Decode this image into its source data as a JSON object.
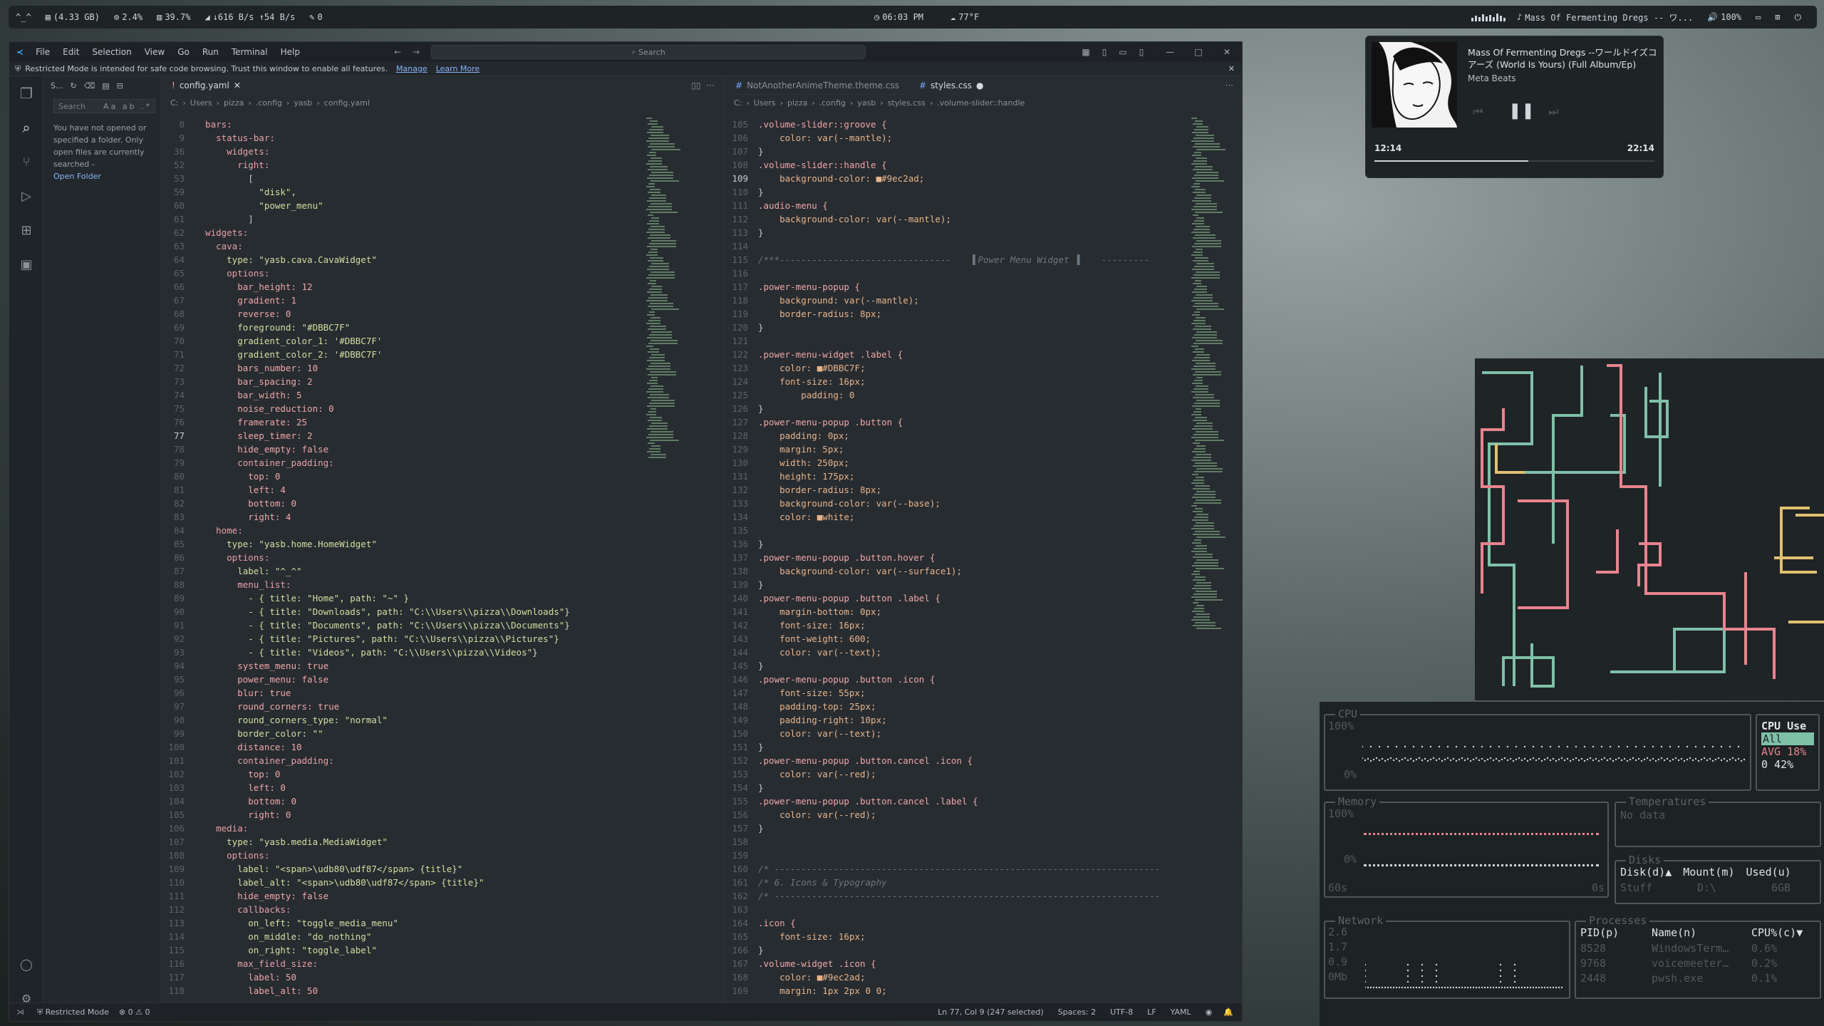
{
  "statusbar": {
    "logo": "^_^",
    "memory": "(4.33 GB)",
    "cpu": "2.4%",
    "ram": "39.7%",
    "network": "↓616 B/s ↑54 B/s",
    "notes": "0",
    "time": "06:03 PM",
    "weather": "77°F",
    "now_playing": "Mass Of Fermenting Dregs -- ワ...",
    "volume": "100%"
  },
  "vscode": {
    "menus": [
      "File",
      "Edit",
      "Selection",
      "View",
      "Go",
      "Run",
      "Terminal",
      "Help"
    ],
    "search_placeholder": "Search",
    "restricted_text": "Restricted Mode is intended for safe code browsing. Trust this window to enable all features.",
    "manage": "Manage",
    "learn_more": "Learn More",
    "sidebar": {
      "title": "S...",
      "search_placeholder": "Search",
      "message": "You have not opened or specified a folder. Only open files are currently searched -",
      "open_folder": "Open Folder"
    },
    "left_tab": "config.yaml",
    "left_crumbs": [
      "C:",
      "Users",
      "pizza",
      ".config",
      "yasb",
      "config.yaml"
    ],
    "right_tabs": [
      "NotAnotherAnimeTheme.theme.css",
      "styles.css"
    ],
    "right_crumbs": [
      "C:",
      "Users",
      "pizza",
      ".config",
      "yasb",
      "styles.css",
      ".volume-slider::handle"
    ],
    "status": {
      "mode": "Restricted Mode",
      "problems": "0 ⚠ 0",
      "position": "Ln 77, Col 9 (247 selected)",
      "spaces": "Spaces: 2",
      "encoding": "UTF-8",
      "eol": "LF",
      "language": "YAML"
    }
  },
  "yaml_lines": [
    [
      "8",
      "  bars:"
    ],
    [
      "9",
      "    status-bar:"
    ],
    [
      "36",
      "      widgets:"
    ],
    [
      "52",
      "        right:"
    ],
    [
      "53",
      "          ["
    ],
    [
      "59",
      "            \"disk\","
    ],
    [
      "60",
      "            \"power_menu\""
    ],
    [
      "61",
      "          ]"
    ],
    [
      "62",
      "  widgets:"
    ],
    [
      "63",
      "    cava:"
    ],
    [
      "64",
      "      type: \"yasb.cava.CavaWidget\""
    ],
    [
      "65",
      "      options:"
    ],
    [
      "66",
      "        bar_height: 12"
    ],
    [
      "67",
      "        gradient: 1"
    ],
    [
      "68",
      "        reverse: 0"
    ],
    [
      "69",
      "        foreground: \"#DBBC7F\""
    ],
    [
      "70",
      "        gradient_color_1: '#DBBC7F'"
    ],
    [
      "71",
      "        gradient_color_2: '#DBBC7F'"
    ],
    [
      "72",
      "        bars_number: 10"
    ],
    [
      "73",
      "        bar_spacing: 2"
    ],
    [
      "74",
      "        bar_width: 5"
    ],
    [
      "75",
      "        noise_reduction: 0"
    ],
    [
      "76",
      "        framerate: 25"
    ],
    [
      "77",
      "        sleep_timer: 2"
    ],
    [
      "78",
      "        hide_empty: false"
    ],
    [
      "79",
      "        container_padding:"
    ],
    [
      "80",
      "          top: 0"
    ],
    [
      "81",
      "          left: 4"
    ],
    [
      "82",
      "          bottom: 0"
    ],
    [
      "83",
      "          right: 4"
    ],
    [
      "84",
      "    home:"
    ],
    [
      "85",
      "      type: \"yasb.home.HomeWidget\""
    ],
    [
      "86",
      "      options:"
    ],
    [
      "87",
      "        label: \"^_^\""
    ],
    [
      "88",
      "        menu_list:"
    ],
    [
      "89",
      "          - { title: \"Home\", path: \"~\" }"
    ],
    [
      "90",
      "          - { title: \"Downloads\", path: \"C:\\\\Users\\\\pizza\\\\Downloads\"}"
    ],
    [
      "91",
      "          - { title: \"Documents\", path: \"C:\\\\Users\\\\pizza\\\\Documents\"}"
    ],
    [
      "92",
      "          - { title: \"Pictures\", path: \"C:\\\\Users\\\\pizza\\\\Pictures\"}"
    ],
    [
      "93",
      "          - { title: \"Videos\", path: \"C:\\\\Users\\\\pizza\\\\Videos\"}"
    ],
    [
      "94",
      "        system_menu: true"
    ],
    [
      "95",
      "        power_menu: false"
    ],
    [
      "96",
      "        blur: true"
    ],
    [
      "97",
      "        round_corners: true"
    ],
    [
      "98",
      "        round_corners_type: \"normal\""
    ],
    [
      "99",
      "        border_color: \"\""
    ],
    [
      "100",
      "        distance: 10"
    ],
    [
      "101",
      "        container_padding:"
    ],
    [
      "102",
      "          top: 0"
    ],
    [
      "103",
      "          left: 0"
    ],
    [
      "104",
      "          bottom: 0"
    ],
    [
      "105",
      "          right: 0"
    ],
    [
      "106",
      "    media:"
    ],
    [
      "107",
      "      type: \"yasb.media.MediaWidget\""
    ],
    [
      "108",
      "      options:"
    ],
    [
      "109",
      "        label: \"<span>\\udb80\\udf87</span> {title}\""
    ],
    [
      "110",
      "        label_alt: \"<span>\\udb80\\udf87</span> {title}\""
    ],
    [
      "111",
      "        hide_empty: false"
    ],
    [
      "112",
      "        callbacks:"
    ],
    [
      "113",
      "          on_left: \"toggle_media_menu\""
    ],
    [
      "114",
      "          on_middle: \"do_nothing\""
    ],
    [
      "115",
      "          on_right: \"toggle_label\""
    ],
    [
      "116",
      "        max_field_size:"
    ],
    [
      "117",
      "          label: 50"
    ],
    [
      "118",
      "          label_alt: 50"
    ]
  ],
  "css_lines": [
    [
      "105",
      ".volume-slider::groove {"
    ],
    [
      "106",
      "    color: var(--mantle);"
    ],
    [
      "107",
      "}"
    ],
    [
      "108",
      ".volume-slider::handle {"
    ],
    [
      "109",
      "    background-color: ■#9ec2ad;"
    ],
    [
      "110",
      "}"
    ],
    [
      "111",
      ".audio-menu {"
    ],
    [
      "112",
      "    background-color: var(--mantle);"
    ],
    [
      "113",
      "}"
    ],
    [
      "114",
      ""
    ],
    [
      "115",
      "/***--------------------------------    ▌Power Menu Widget ▐    ---------"
    ],
    [
      "116",
      ""
    ],
    [
      "117",
      ".power-menu-popup {"
    ],
    [
      "118",
      "    background: var(--mantle);"
    ],
    [
      "119",
      "    border-radius: 8px;"
    ],
    [
      "120",
      "}"
    ],
    [
      "121",
      ""
    ],
    [
      "122",
      ".power-menu-widget .label {"
    ],
    [
      "123",
      "    color: ■#DBBC7F;"
    ],
    [
      "124",
      "    font-size: 16px;"
    ],
    [
      "125",
      "        padding: 0"
    ],
    [
      "126",
      "}"
    ],
    [
      "127",
      ".power-menu-popup .button {"
    ],
    [
      "128",
      "    padding: 0px;"
    ],
    [
      "129",
      "    margin: 5px;"
    ],
    [
      "130",
      "    width: 250px;"
    ],
    [
      "131",
      "    height: 175px;"
    ],
    [
      "132",
      "    border-radius: 8px;"
    ],
    [
      "133",
      "    background-color: var(--base);"
    ],
    [
      "134",
      "    color: ■white;"
    ],
    [
      "135",
      ""
    ],
    [
      "136",
      "}"
    ],
    [
      "137",
      ".power-menu-popup .button.hover {"
    ],
    [
      "138",
      "    background-color: var(--surface1);"
    ],
    [
      "139",
      "}"
    ],
    [
      "140",
      ".power-menu-popup .button .label {"
    ],
    [
      "141",
      "    margin-bottom: 0px;"
    ],
    [
      "142",
      "    font-size: 16px;"
    ],
    [
      "143",
      "    font-weight: 600;"
    ],
    [
      "144",
      "    color: var(--text);"
    ],
    [
      "145",
      "}"
    ],
    [
      "146",
      ".power-menu-popup .button .icon {"
    ],
    [
      "147",
      "    font-size: 55px;"
    ],
    [
      "148",
      "    padding-top: 25px;"
    ],
    [
      "149",
      "    padding-right: 10px;"
    ],
    [
      "150",
      "    color: var(--text);"
    ],
    [
      "151",
      "}"
    ],
    [
      "152",
      ".power-menu-popup .button.cancel .icon {"
    ],
    [
      "153",
      "    color: var(--red);"
    ],
    [
      "154",
      "}"
    ],
    [
      "155",
      ".power-menu-popup .button.cancel .label {"
    ],
    [
      "156",
      "    color: var(--red);"
    ],
    [
      "157",
      "}"
    ],
    [
      "158",
      ""
    ],
    [
      "159",
      ""
    ],
    [
      "160",
      "/* ------------------------------------------------------------------------"
    ],
    [
      "161",
      "/* 6. Icons & Typography"
    ],
    [
      "162",
      "/* ------------------------------------------------------------------------"
    ],
    [
      "163",
      ""
    ],
    [
      "164",
      ".icon {"
    ],
    [
      "165",
      "    font-size: 16px;"
    ],
    [
      "166",
      "}"
    ],
    [
      "167",
      ".volume-widget .icon {"
    ],
    [
      "168",
      "    color: ■#9ec2ad;"
    ],
    [
      "169",
      "    margin: 1px 2px 0 0;"
    ]
  ],
  "media": {
    "title": "Mass Of Fermenting Dregs --ワールドイズコアーズ (World Is Yours) (Full Album/Ep)",
    "artist": "Meta Beats",
    "elapsed": "12:14",
    "total": "22:14",
    "progress": 0.55
  },
  "btop": {
    "cpu_title": "CPU",
    "cpu_100": "100%",
    "cpu_0": "0%",
    "cpu_use_title": "CPU Use",
    "cpu_all": "All",
    "cpu_avg": "AVG 18%",
    "cpu_core": "0   42%",
    "mem_title": "Memory",
    "mem_100": "100%",
    "mem_0": "0%",
    "mem_60s": "60s",
    "mem_0s": "0s",
    "temp_title": "Temperatures",
    "temp_empty": "No data",
    "disks_title": "Disks",
    "disks_headers": [
      "Disk(d)▲",
      "Mount(m)",
      "Used(u)"
    ],
    "disks_row": [
      "Stuff",
      "D:\\",
      "6GB"
    ],
    "net_title": "Network",
    "net_scale": [
      "2.6",
      "1.7",
      "0.9",
      "0Mb"
    ],
    "proc_title": "Processes",
    "proc_headers": [
      "PID(p)",
      "Name(n)",
      "CPU%(c)▼"
    ],
    "proc_rows": [
      [
        "8528",
        "WindowsTerm…",
        "0.6%"
      ],
      [
        "9768",
        "voicemeeter…",
        "0.2%"
      ],
      [
        "2448",
        "pwsh.exe",
        "0.1%"
      ]
    ]
  },
  "colors": {
    "accent_green": "#9ec2ad",
    "accent_yellow": "#DBBC7F",
    "pipe_pink": "#e8848f",
    "pipe_yellow": "#e0c070",
    "pipe_teal": "#7fc0a8"
  }
}
